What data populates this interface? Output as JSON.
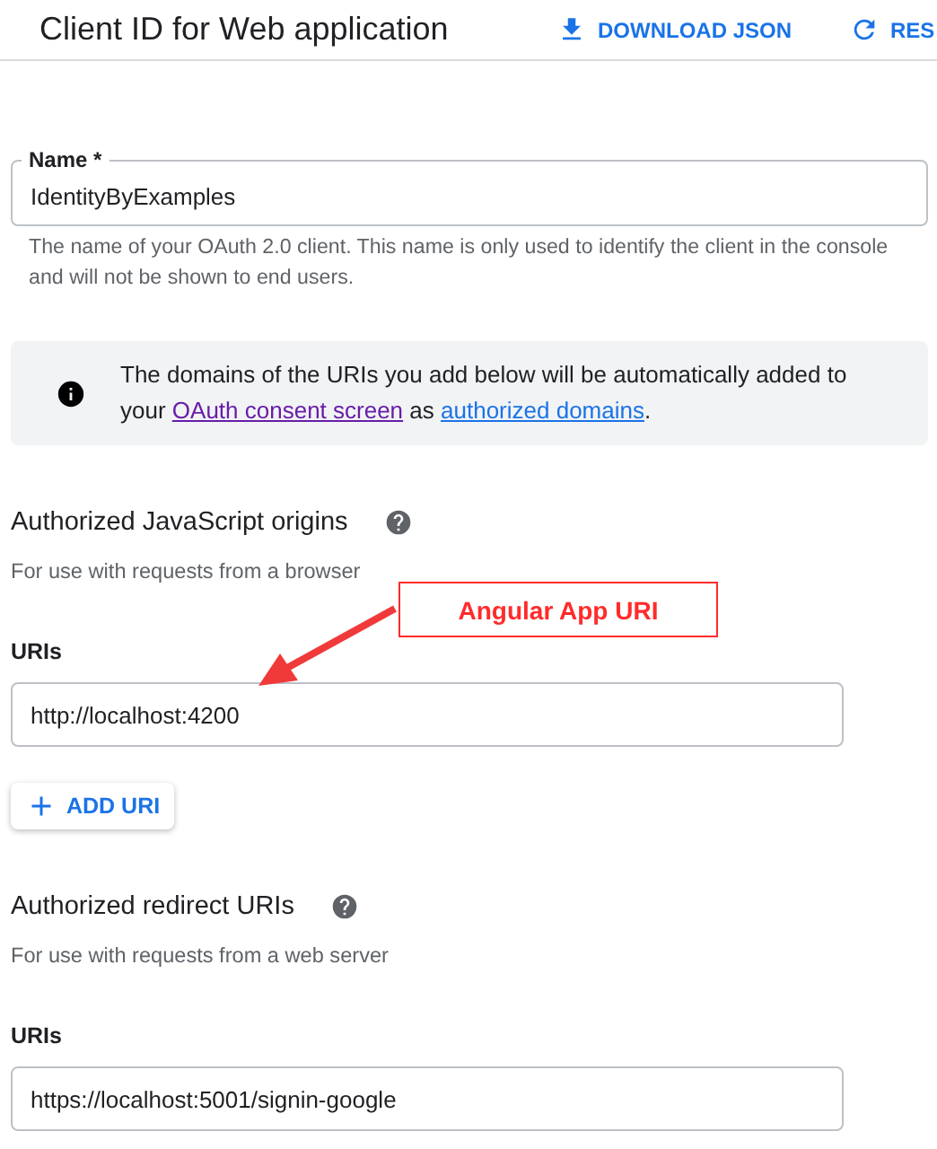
{
  "header": {
    "title": "Client ID for Web application",
    "actions": [
      {
        "kind": "download",
        "label": "DOWNLOAD JSON"
      },
      {
        "kind": "reset",
        "label": "RES"
      }
    ]
  },
  "name_field": {
    "label": "Name *",
    "value": "IdentityByExamples",
    "helper": "The name of your OAuth 2.0 client. This name is only used to identify the client in the console and will not be shown to end users."
  },
  "info": {
    "segments": [
      {
        "kind": "text",
        "text": "The domains of the URIs you add below will be automatically added to your "
      },
      {
        "kind": "link",
        "text": "OAuth consent screen",
        "visited": true
      },
      {
        "kind": "text",
        "text": " as "
      },
      {
        "kind": "link",
        "text": "authorized domains",
        "visited": false
      },
      {
        "kind": "text",
        "text": "."
      }
    ]
  },
  "sections": [
    {
      "title": "Authorized JavaScript origins",
      "subtitle": "For use with requests from a browser",
      "uris_label": "URIs",
      "uris": [
        "http://localhost:4200"
      ],
      "add_button": "ADD URI"
    },
    {
      "title": "Authorized redirect URIs",
      "subtitle": "For use with requests from a web server",
      "uris_label": "URIs",
      "uris": [
        "https://localhost:5001/signin-google"
      ]
    }
  ],
  "annotation": {
    "text": "Angular App URI"
  }
}
